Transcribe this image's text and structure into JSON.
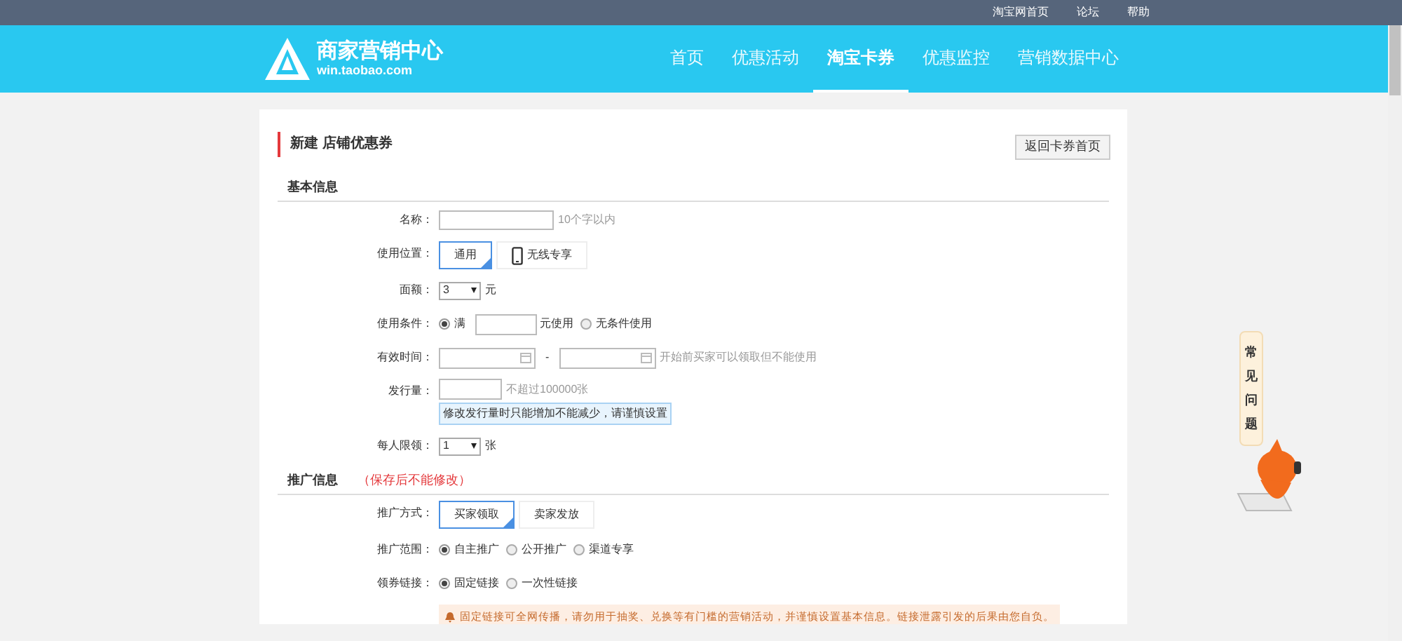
{
  "top_links": [
    "淘宝网首页",
    "论坛",
    "帮助"
  ],
  "logo": {
    "title": "商家营销中心",
    "url": "win.taobao.com"
  },
  "nav": [
    {
      "label": "首页",
      "selected": false
    },
    {
      "label": "优惠活动",
      "selected": false
    },
    {
      "label": "淘宝卡券",
      "selected": true
    },
    {
      "label": "优惠监控",
      "selected": false
    },
    {
      "label": "营销数据中心",
      "selected": false
    }
  ],
  "card": {
    "title": "新建 店铺优惠券",
    "back_button": "返回卡券首页"
  },
  "sections": [
    {
      "title": "基本信息",
      "rows": [
        {
          "kind": "text",
          "label": "名称：",
          "hint": "10个字以内"
        },
        {
          "kind": "tiles",
          "label": "使用位置：",
          "options": [
            {
              "label": "通用",
              "selected": true
            },
            {
              "label": "无线专享",
              "selected": false
            }
          ]
        },
        {
          "kind": "select",
          "label": "面额：",
          "value": "3",
          "unit": "元"
        },
        {
          "kind": "radio",
          "label": "使用条件：",
          "options": [
            {
              "label": "满",
              "selected": true,
              "suffix": "元使用"
            },
            {
              "label": "无条件使用",
              "selected": false
            }
          ]
        },
        {
          "kind": "dates",
          "label": "有效时间：",
          "separator": "-",
          "hint": "开始前买家可以领取但不能使用"
        },
        {
          "kind": "number",
          "label": "发行量：",
          "hint": "不超过100000张",
          "tip": "修改发行量时只能增加不能减少，请谨慎设置"
        },
        {
          "kind": "select",
          "label": "每人限领：",
          "value": "1",
          "unit": "张"
        }
      ]
    },
    {
      "title": "推广信息",
      "note": "（保存后不能修改）",
      "rows": [
        {
          "kind": "tiles",
          "label": "推广方式：",
          "options": [
            {
              "label": "买家领取",
              "selected": true
            },
            {
              "label": "卖家发放",
              "selected": false
            }
          ]
        },
        {
          "kind": "radio",
          "label": "推广范围：",
          "options": [
            {
              "label": "自主推广",
              "selected": true
            },
            {
              "label": "公开推广",
              "selected": false
            },
            {
              "label": "渠道专享",
              "selected": false
            }
          ]
        },
        {
          "kind": "radio",
          "label": "领券链接：",
          "options": [
            {
              "label": "固定链接",
              "selected": true
            },
            {
              "label": "一次性链接",
              "selected": false
            }
          ]
        },
        {
          "kind": "notice",
          "text": "固定链接可全网传播，请勿用于抽奖、兑换等有门槛的营销活动，并谨慎设置基本信息。链接泄露引发的后果由您自负。"
        }
      ]
    }
  ],
  "faq": {
    "label": "常见问题"
  }
}
